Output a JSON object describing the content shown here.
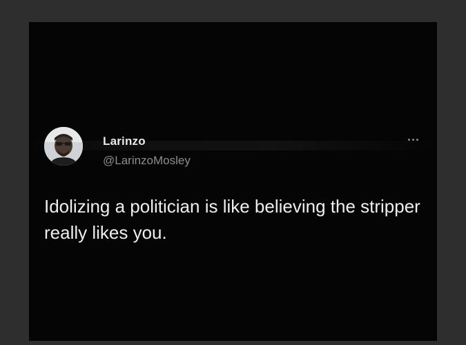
{
  "tweet": {
    "author_name": "Larinzo",
    "author_handle": "@LarinzoMosley",
    "text": "Idolizing a politician is like believing the stripper really likes you.",
    "avatar_icon": "user-avatar-photo",
    "menu_icon": "more-horizontal-icon"
  },
  "colors": {
    "background": "#2e2e2e",
    "card": "#050505",
    "name": "#e9e9e9",
    "handle": "#8d8d8d",
    "text": "#eeeeee"
  }
}
